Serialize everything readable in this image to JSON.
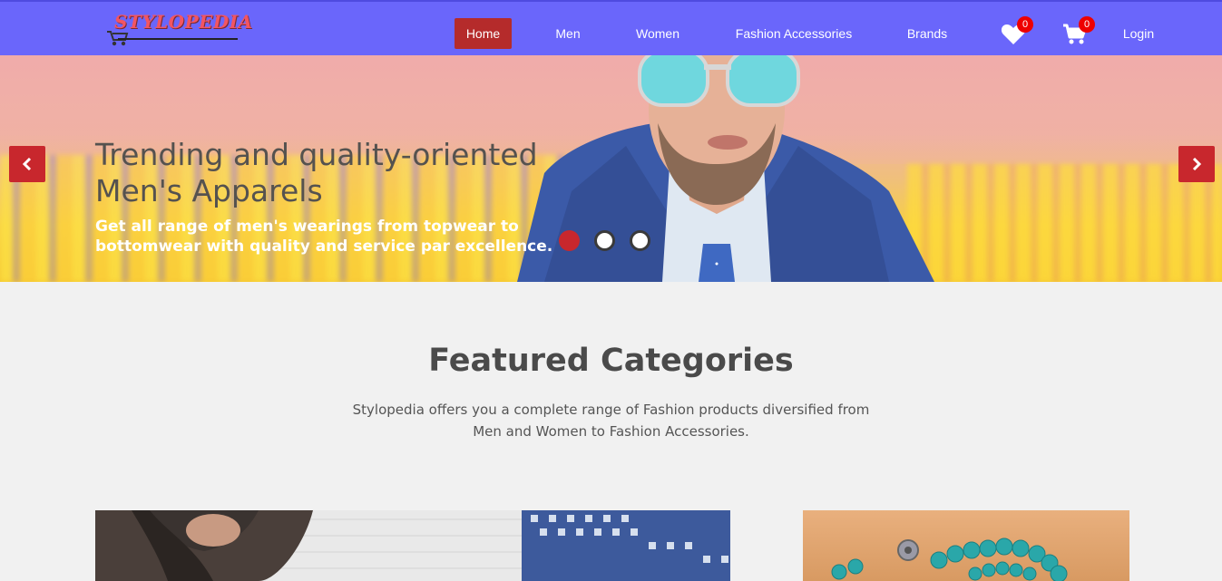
{
  "brand": {
    "name": "Stylopedia",
    "logo_text": "STYLOPEDIA"
  },
  "nav": {
    "items": [
      {
        "label": "Home",
        "active": true
      },
      {
        "label": "Men"
      },
      {
        "label": "Women"
      },
      {
        "label": "Fashion Accessories"
      },
      {
        "label": "Brands"
      }
    ],
    "wishlist": {
      "icon": "heart-icon",
      "count": "0"
    },
    "cart": {
      "icon": "cart-icon",
      "count": "0"
    },
    "login_label": "Login"
  },
  "hero": {
    "title": "Trending and quality-oriented Men's Apparels",
    "subtitle": "Get all range of men's wearings from topwear to bottomwear with quality and service par excellence.",
    "prev_icon": "chevron-left-icon",
    "next_icon": "chevron-right-icon",
    "slides_count": 3,
    "active_slide": 1
  },
  "featured": {
    "title": "Featured Categories",
    "description": "Stylopedia offers you a complete range of Fashion products diversified from Men and Women to Fashion Accessories."
  },
  "colors": {
    "nav_bg": "#6a66fb",
    "active_nav": "#b52b2b",
    "accent_red": "#c8272d",
    "badge": "#e00000",
    "page_bg": "#f1f1f1"
  }
}
